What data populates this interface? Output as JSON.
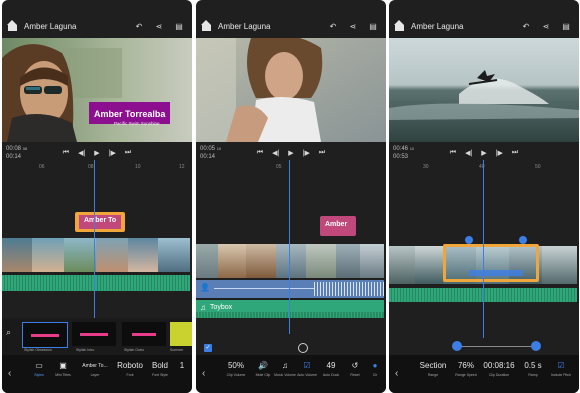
{
  "screens": [
    {
      "title": "Amber Laguna",
      "overlay_title": "Amber Torrealba",
      "overlay_subtitle": "Pacific Swim Sunshine",
      "timecode_current": "00:08",
      "timecode_frames": "08",
      "timecode_total": "00:14",
      "ruler": [
        "06",
        "08",
        "10",
        "12"
      ],
      "title_clip_label": "Amber To",
      "styles": [
        "Stylish Obsession",
        "Stylish Intro",
        "Stylish Outro",
        "Summer"
      ],
      "tools": [
        {
          "label": "Styles",
          "text": "▭",
          "selected": true
        },
        {
          "label": "Mini Titles",
          "text": "▣"
        },
        {
          "label": "Layer",
          "text": "Amber To..."
        },
        {
          "label": "Font",
          "text": "Roboto"
        },
        {
          "label": "Font Style",
          "text": "Bold"
        },
        {
          "label": "",
          "text": "1"
        }
      ]
    },
    {
      "title": "Amber Laguna",
      "timecode_current": "00:05",
      "timecode_frames": "10",
      "timecode_total": "00:14",
      "ruler": [
        "05"
      ],
      "title_clip_label": "Amber",
      "music_label": "Toybox",
      "tools": [
        {
          "label": "Clip Volume",
          "text": "50%"
        },
        {
          "label": "Mute Clip",
          "text": "🔊"
        },
        {
          "label": "Music Volume",
          "text": "♫"
        },
        {
          "label": "Auto Volume",
          "text": "☑"
        },
        {
          "label": "Auto Duck",
          "text": "49"
        },
        {
          "label": "Reset",
          "text": "↺"
        },
        {
          "label": "Clr",
          "text": "●"
        }
      ]
    },
    {
      "title": "Amber Laguna",
      "timecode_current": "00:46",
      "timecode_frames": "10",
      "timecode_total": "00:53",
      "ruler": [
        "30",
        "40",
        "50"
      ],
      "tools": [
        {
          "label": "Range",
          "text": "Section"
        },
        {
          "label": "Range Speed",
          "text": "76%"
        },
        {
          "label": "Clip Duration",
          "text": "00:08:16"
        },
        {
          "label": "Ramp",
          "text": "0.5 s"
        },
        {
          "label": "Include Pitch",
          "text": "☑"
        }
      ]
    }
  ],
  "colors": {
    "accent_blue": "#3d7ee6",
    "title_purple": "#8b0f8e",
    "clip_orange": "#f0a63b",
    "title_clip_pink": "#c0487a",
    "audio_green": "#2fa77a"
  }
}
